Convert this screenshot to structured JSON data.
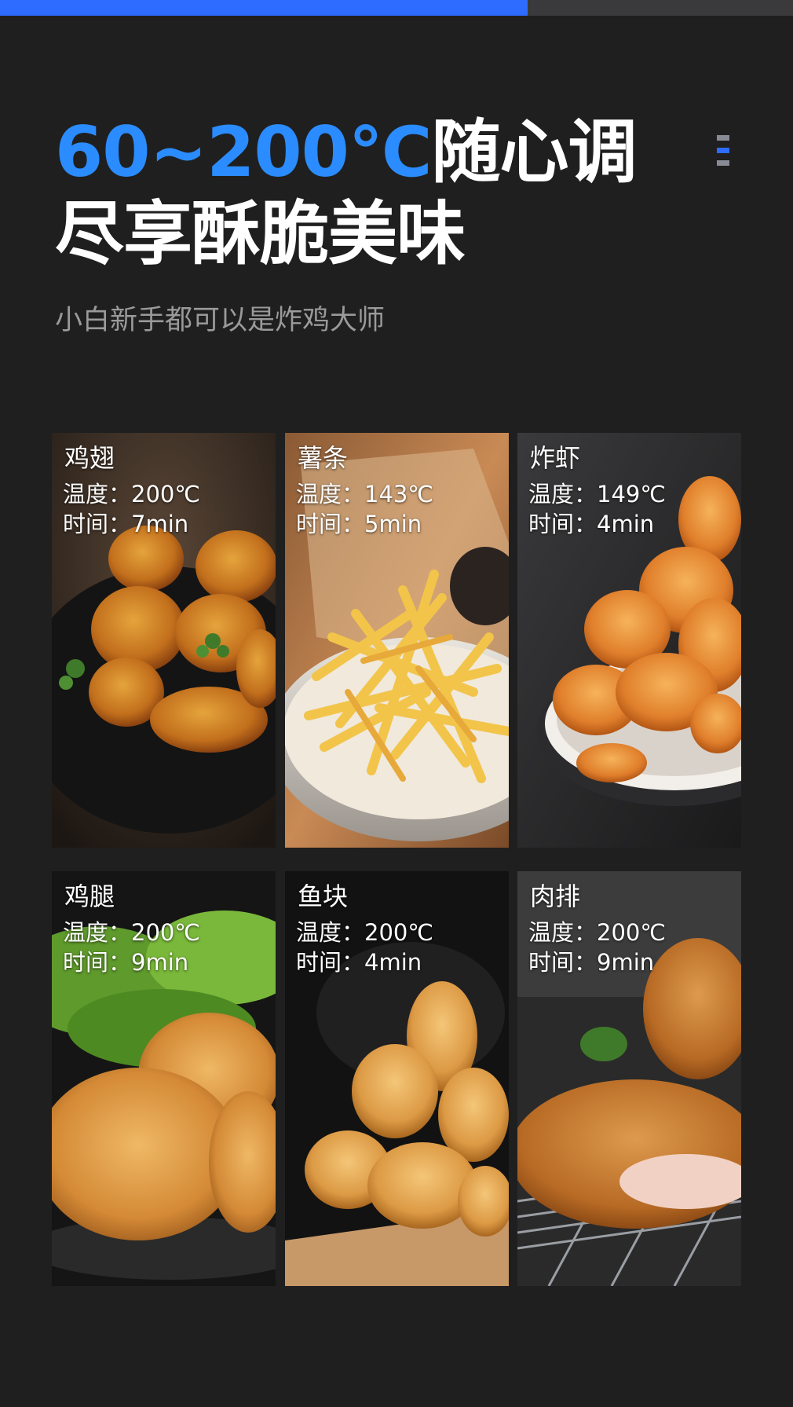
{
  "progress": {
    "value_fraction": 0.665
  },
  "headline": {
    "range": "60~200℃",
    "line1_suffix": "随心调",
    "line2": "尽享酥脆美味"
  },
  "subtitle": "小白新手都可以是炸鸡大师",
  "colors": {
    "accent": "#2b8cff",
    "background": "#1f1f1f",
    "subtitle": "#9a9a9a"
  },
  "recipes": [
    {
      "name": "鸡翅",
      "temp": "温度：200℃",
      "time": "时间：7min",
      "icon": "chicken-wings-photo"
    },
    {
      "name": "薯条",
      "temp": "温度：143℃",
      "time": "时间：5min",
      "icon": "french-fries-photo"
    },
    {
      "name": "炸虾",
      "temp": "温度：149℃",
      "time": "时间：4min",
      "icon": "fried-shrimp-photo"
    },
    {
      "name": "鸡腿",
      "temp": "温度：200℃",
      "time": "时间：9min",
      "icon": "chicken-leg-photo"
    },
    {
      "name": "鱼块",
      "temp": "温度：200℃",
      "time": "时间：4min",
      "icon": "fish-nuggets-photo"
    },
    {
      "name": "肉排",
      "temp": "温度：200℃",
      "time": "时间：9min",
      "icon": "pork-cutlet-photo"
    }
  ]
}
